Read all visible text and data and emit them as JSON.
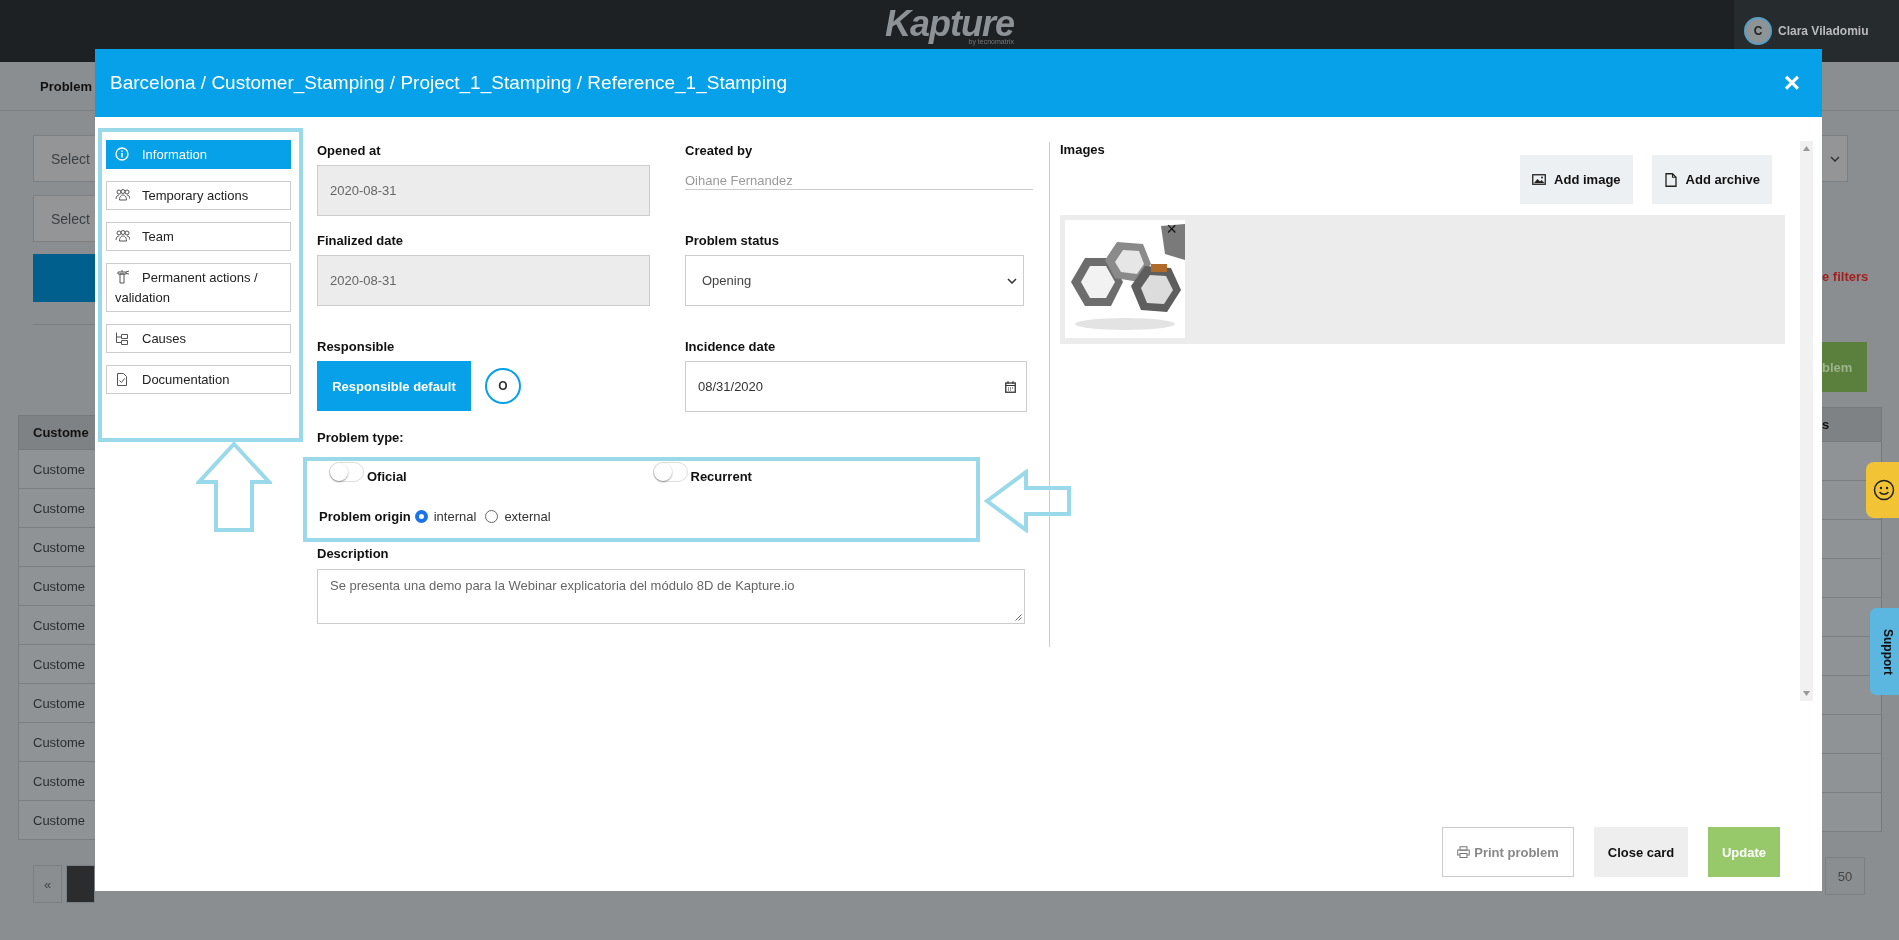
{
  "top_bar": {
    "logo": "Kapture",
    "logo_sub": "by tecnomatrix",
    "user": {
      "initial": "C",
      "name": "Clara Viladomiu"
    }
  },
  "background_page": {
    "section_title": "Problem",
    "filters": [
      "Select",
      "Select"
    ],
    "clear_filters": "e filters",
    "new_problem": "blem",
    "table": {
      "columns": [
        "Custome",
        "s"
      ],
      "rows": [
        "Custome",
        "Custome",
        "Custome",
        "Custome",
        "Custome",
        "Custome",
        "Custome",
        "Custome",
        "Custome",
        "Custome"
      ]
    },
    "pagination": {
      "first": "«",
      "page_size": "50"
    }
  },
  "support_tab": "Support",
  "modal": {
    "title": "Barcelona / Customer_Stamping / Project_1_Stamping / Reference_1_Stamping",
    "close": "×",
    "sidebar": [
      {
        "label": "Information",
        "selected": true
      },
      {
        "label": "Temporary actions",
        "selected": false
      },
      {
        "label": "Team",
        "selected": false
      },
      {
        "label": "Permanent actions / validation",
        "selected": false
      },
      {
        "label": "Causes",
        "selected": false
      },
      {
        "label": "Documentation",
        "selected": false
      }
    ],
    "opened_at": {
      "label": "Opened at",
      "value": "2020-08-31"
    },
    "created_by": {
      "label": "Created by",
      "value": "Oihane Fernandez"
    },
    "finalized_date": {
      "label": "Finalized date",
      "value": "2020-08-31"
    },
    "problem_status": {
      "label": "Problem status",
      "value": "Opening"
    },
    "responsible": {
      "label": "Responsible",
      "button": "Responsible default",
      "circle": "O"
    },
    "incidence_date": {
      "label": "Incidence date",
      "value": "08/31/2020"
    },
    "problem_type": {
      "label": "Problem type:",
      "toggles": [
        {
          "label": "Oficial",
          "on": false
        },
        {
          "label": "Recurrent",
          "on": false
        }
      ]
    },
    "problem_origin": {
      "label": "Problem origin",
      "options": [
        {
          "label": "internal",
          "selected": true
        },
        {
          "label": "external",
          "selected": false
        }
      ]
    },
    "description": {
      "label": "Description",
      "value": "Se presenta una demo para la Webinar explicatoria del módulo 8D de Kapture.io"
    },
    "images": {
      "label": "Images",
      "buttons": [
        "Add image",
        "Add archive"
      ],
      "items": [
        {
          "kind": "picture",
          "remove": "×"
        }
      ]
    },
    "footer_buttons": [
      {
        "label": "Print problem",
        "kind": "outline"
      },
      {
        "label": "Close card",
        "kind": "secondary"
      },
      {
        "label": "Update",
        "kind": "success"
      }
    ]
  }
}
